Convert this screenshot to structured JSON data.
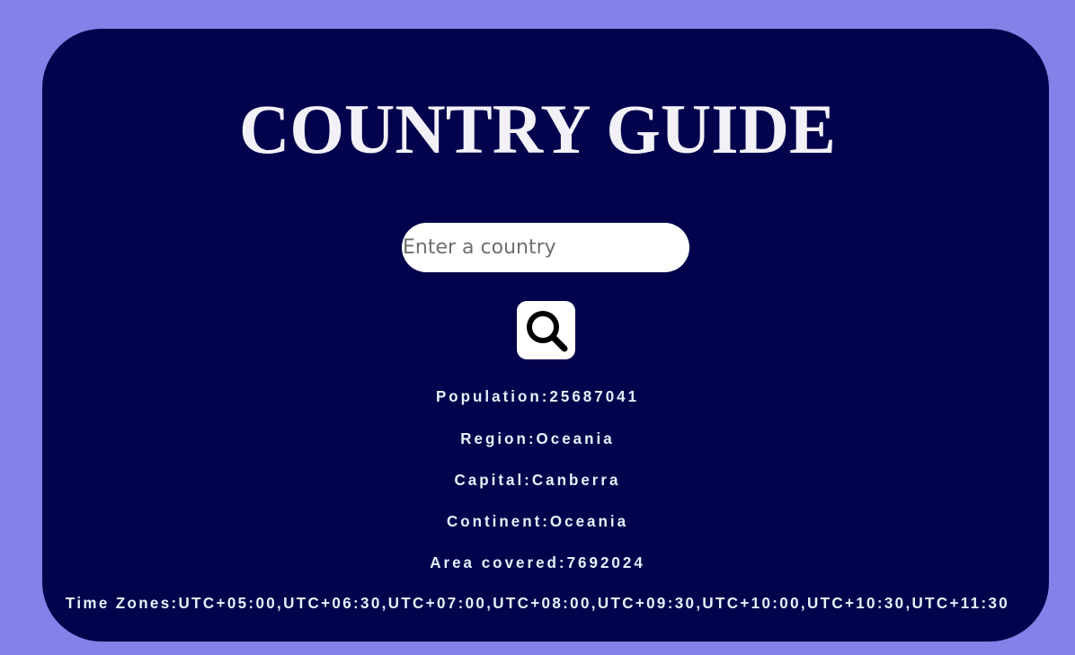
{
  "app": {
    "title": "COUNTRY GUIDE"
  },
  "search": {
    "placeholder": "Enter a country",
    "value": "",
    "button_icon": "search-icon"
  },
  "details": {
    "population": "Population:25687041",
    "region": "Region:Oceania",
    "capital": "Capital:Canberra",
    "continent": "Continent:Oceania",
    "area": "Area covered:7692024",
    "timezones": "Time Zones:UTC+05:00,UTC+06:30,UTC+07:00,UTC+08:00,UTC+09:30,UTC+10:00,UTC+10:30,UTC+11:30"
  },
  "colors": {
    "page_background": "#8481e8",
    "card_background": "#02034c",
    "title_text": "#f3f1f8",
    "detail_text": "#e4f2fb"
  }
}
